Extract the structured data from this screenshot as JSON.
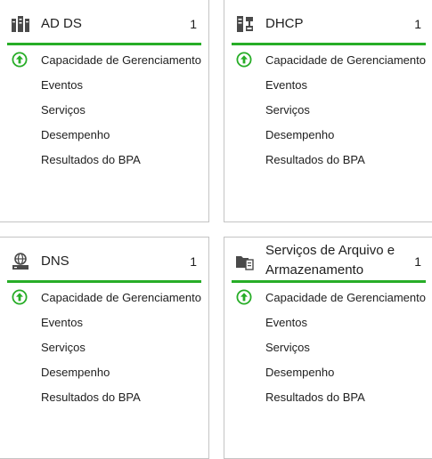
{
  "colors": {
    "accent_bar": "#27ad27",
    "status_up": "#27ad27"
  },
  "tiles": [
    {
      "title": "AD DS",
      "count": "1",
      "icon": "server-role-icon",
      "rows": [
        {
          "label": "Capacidade de Gerenciamento",
          "status": "up-arrow-icon"
        },
        {
          "label": "Eventos"
        },
        {
          "label": "Serviços"
        },
        {
          "label": "Desempenho"
        },
        {
          "label": "Resultados do BPA"
        }
      ]
    },
    {
      "title": "DHCP",
      "count": "1",
      "icon": "server-role-icon",
      "rows": [
        {
          "label": "Capacidade de Gerenciamento",
          "status": "up-arrow-icon"
        },
        {
          "label": "Eventos"
        },
        {
          "label": "Serviços"
        },
        {
          "label": "Desempenho"
        },
        {
          "label": "Resultados do BPA"
        }
      ]
    },
    {
      "title": "DNS",
      "count": "1",
      "icon": "server-role-icon",
      "rows": [
        {
          "label": "Capacidade de Gerenciamento",
          "status": "up-arrow-icon"
        },
        {
          "label": "Eventos"
        },
        {
          "label": "Serviços"
        },
        {
          "label": "Desempenho"
        },
        {
          "label": "Resultados do BPA"
        }
      ]
    },
    {
      "title": "Serviços de Arquivo e Armazenamento",
      "count": "1",
      "icon": "folder-server-icon",
      "rows": [
        {
          "label": "Capacidade de Gerenciamento",
          "status": "up-arrow-icon"
        },
        {
          "label": "Eventos"
        },
        {
          "label": "Serviços"
        },
        {
          "label": "Desempenho"
        },
        {
          "label": "Resultados do BPA"
        }
      ]
    }
  ]
}
